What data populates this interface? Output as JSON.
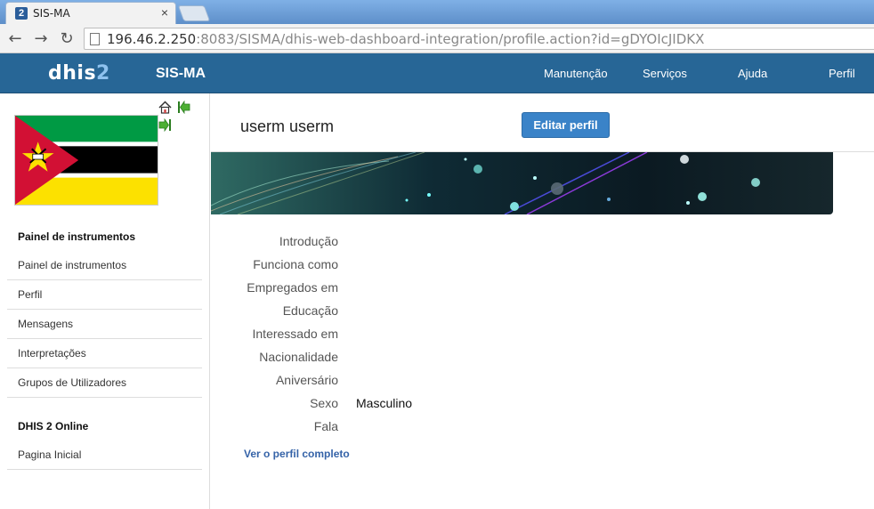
{
  "browser": {
    "tab_title": "SIS-MA",
    "tab_favicon": "2",
    "tab_close": "×",
    "url_host": "196.46.2.250",
    "url_rest": ":8083/SISMA/dhis-web-dashboard-integration/profile.action?id=gDYOIcJIDKX"
  },
  "header": {
    "logo_text": "dhis",
    "logo_num": "2",
    "app_title": "SIS-MA",
    "menu": [
      "Manutenção",
      "Serviços",
      "Ajuda",
      "Perfil"
    ]
  },
  "sidebar": {
    "icons": [
      "home-icon",
      "back-arrow-icon",
      "forward-arrow-icon"
    ],
    "section1_heading": "Painel de instrumentos",
    "section1_links": [
      "Painel de instrumentos",
      "Perfil",
      "Mensagens",
      "Interpretações",
      "Grupos de Utilizadores"
    ],
    "section2_heading": "DHIS 2 Online",
    "section2_links": [
      "Pagina Inicial"
    ]
  },
  "profile": {
    "name": "userm userm",
    "edit_button": "Editar perfil",
    "fields": [
      {
        "label": "Introdução",
        "value": ""
      },
      {
        "label": "Funciona como",
        "value": ""
      },
      {
        "label": "Empregados em",
        "value": ""
      },
      {
        "label": "Educação",
        "value": ""
      },
      {
        "label": "Interessado em",
        "value": ""
      },
      {
        "label": "Nacionalidade",
        "value": ""
      },
      {
        "label": "Aniversário",
        "value": ""
      },
      {
        "label": "Sexo",
        "value": "Masculino"
      },
      {
        "label": "Fala",
        "value": ""
      }
    ],
    "full_profile_link": "Ver o perfil completo"
  },
  "colors": {
    "header_bg": "#276696",
    "button_bg": "#3a83c8",
    "link": "#3563a8"
  }
}
